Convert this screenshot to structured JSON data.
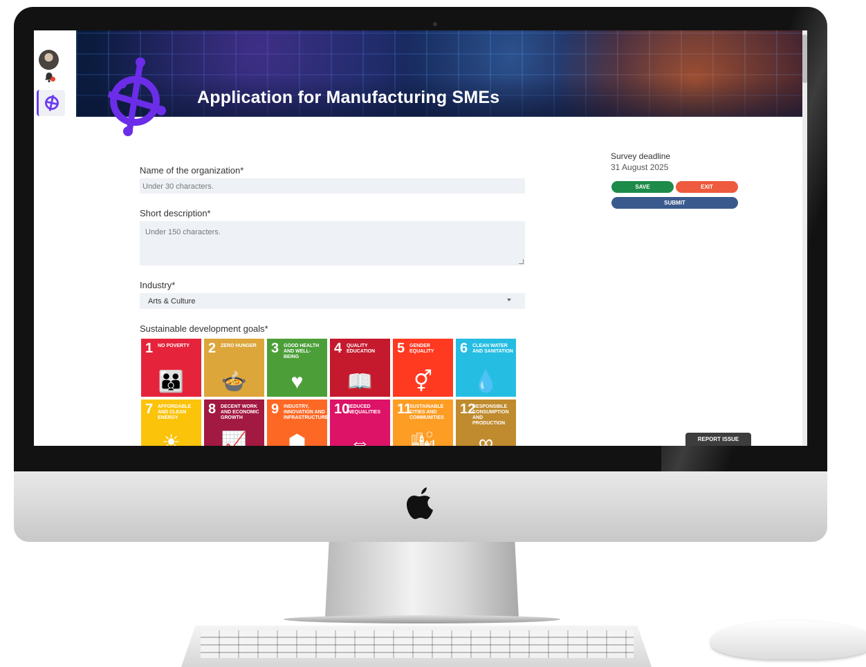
{
  "banner": {
    "title": "Application for Manufacturing SMEs"
  },
  "form": {
    "org_name": {
      "label": "Name of the organization*",
      "placeholder": "Under 30 characters."
    },
    "description": {
      "label": "Short description*",
      "placeholder": "Under 150 characters."
    },
    "industry": {
      "label": "Industry*",
      "selected": "Arts & Culture"
    },
    "sdg": {
      "label": "Sustainable development goals*",
      "goals": [
        {
          "num": "1",
          "name": "No poverty",
          "color": "#e5243b",
          "icon": "people-icon"
        },
        {
          "num": "2",
          "name": "Zero hunger",
          "color": "#dda63a",
          "icon": "bowl-icon"
        },
        {
          "num": "3",
          "name": "Good health and well-being",
          "color": "#4c9f38",
          "icon": "heartbeat-icon"
        },
        {
          "num": "4",
          "name": "Quality education",
          "color": "#c5192d",
          "icon": "book-icon"
        },
        {
          "num": "5",
          "name": "Gender equality",
          "color": "#ff3a21",
          "icon": "gender-icon"
        },
        {
          "num": "6",
          "name": "Clean water and sanitation",
          "color": "#26bde2",
          "icon": "water-drop-icon"
        },
        {
          "num": "7",
          "name": "Affordable and clean energy",
          "color": "#fcc30b",
          "icon": "sun-icon"
        },
        {
          "num": "8",
          "name": "Decent work and economic growth",
          "color": "#a21942",
          "icon": "growth-chart-icon"
        },
        {
          "num": "9",
          "name": "Industry, innovation and infrastructure",
          "color": "#fd6925",
          "icon": "cubes-icon"
        },
        {
          "num": "10",
          "name": "Reduced inequalities",
          "color": "#dd1367",
          "icon": "equality-icon"
        },
        {
          "num": "11",
          "name": "Sustainable cities and communities",
          "color": "#fd9d24",
          "icon": "city-icon"
        },
        {
          "num": "12",
          "name": "Responsible consumption and production",
          "color": "#bf8b2e",
          "icon": "infinity-icon"
        }
      ]
    }
  },
  "survey": {
    "label": "Survey deadline",
    "date": "31 August 2025"
  },
  "buttons": {
    "save": "SAVE",
    "exit": "EXIT",
    "submit": "SUBMIT",
    "report": "REPORT ISSUE"
  },
  "colors": {
    "accent": "#6b3cf0",
    "save": "#1e8b4a",
    "exit": "#ee5a3d",
    "submit": "#3a5a8e"
  }
}
